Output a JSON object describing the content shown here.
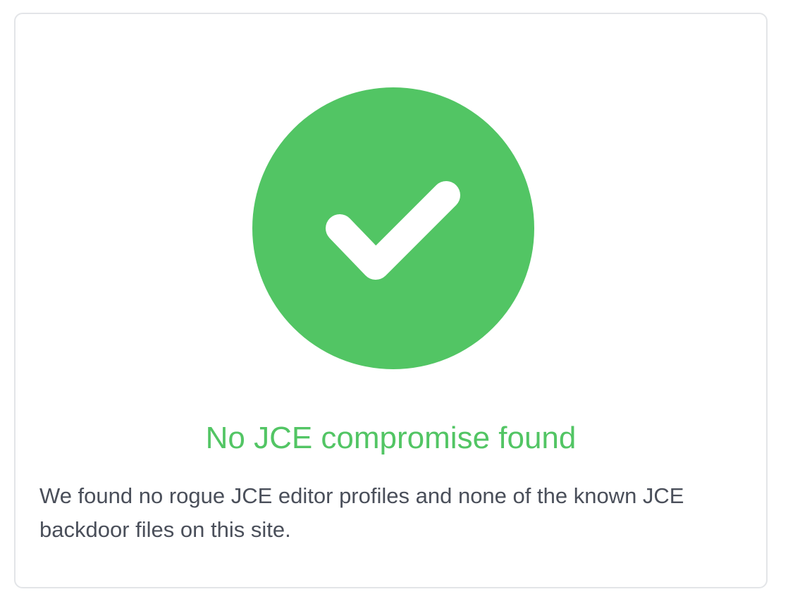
{
  "result": {
    "icon": "check-circle-icon",
    "status_color": "#52c564",
    "title": "No JCE compromise found",
    "message": "We found no rogue JCE editor profiles and none of the known JCE backdoor files on this site."
  }
}
